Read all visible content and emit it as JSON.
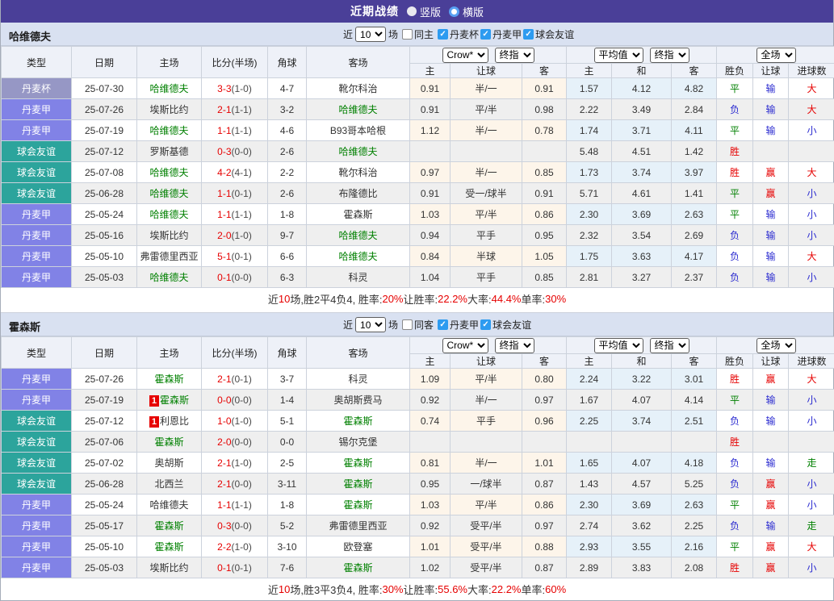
{
  "top_bar": {
    "title": "近期战绩",
    "radio_options": [
      {
        "label": "竖版",
        "selected": false
      },
      {
        "label": "横版",
        "selected": true
      }
    ]
  },
  "colors": {
    "top_bar_bg": "#4a3f98",
    "section_header_bg": "#d9e1f1",
    "cup_badge": "#9697c5",
    "league_badge": "#8182e6",
    "friendly_badge": "#2ca49c",
    "win_red": "#e60000",
    "lose_blue": "#2a2ad0",
    "draw_green": "#008000",
    "handicap_cell_bg": "#fdf5ea",
    "average_cell_bg": "#e6f1f9",
    "checkbox_checked": "#2d9bf0"
  },
  "columns": {
    "left": [
      "类型",
      "日期",
      "主场",
      "比分(半场)",
      "角球",
      "客场"
    ],
    "group1": {
      "selects": [
        "Crow*",
        "终指"
      ],
      "subs": [
        "主",
        "让球",
        "客"
      ]
    },
    "group2": {
      "selects": [
        "平均值",
        "终指"
      ],
      "subs": [
        "主",
        "和",
        "客"
      ]
    },
    "group3": {
      "selects": [
        "全场"
      ],
      "subs": [
        "胜负",
        "让球",
        "进球数"
      ]
    }
  },
  "sections": [
    {
      "title": "哈维德夫",
      "filters": {
        "near_label": "近",
        "count": "10",
        "games_label": "场",
        "same_label": "同主",
        "same_checked": false,
        "leagues": [
          {
            "label": "丹麦杯",
            "checked": true
          },
          {
            "label": "丹麦甲",
            "checked": true
          },
          {
            "label": "球会友谊",
            "checked": true
          }
        ]
      },
      "rows": [
        {
          "league_type": "丹麦杯",
          "league_class": "b-cup",
          "date": "25-07-30",
          "home": "哈维德夫",
          "home_highlight": true,
          "home_red_cards": "",
          "score_full": "3-3",
          "score_half": "(1-0)",
          "corners": "4-7",
          "away": "靴尔科治",
          "away_highlight": false,
          "handicap_odds": [
            "0.91",
            "半/一",
            "0.91"
          ],
          "average_odds": [
            "1.57",
            "4.12",
            "4.82"
          ],
          "results": [
            "平",
            "输",
            "大"
          ]
        },
        {
          "league_type": "丹麦甲",
          "league_class": "b-league",
          "date": "25-07-26",
          "home": "埃斯比约",
          "home_highlight": false,
          "home_red_cards": "",
          "score_full": "2-1",
          "score_half": "(1-1)",
          "corners": "3-2",
          "away": "哈维德夫",
          "away_highlight": true,
          "handicap_odds": [
            "0.91",
            "平/半",
            "0.98"
          ],
          "average_odds": [
            "2.22",
            "3.49",
            "2.84"
          ],
          "results": [
            "负",
            "输",
            "大"
          ]
        },
        {
          "league_type": "丹麦甲",
          "league_class": "b-league",
          "date": "25-07-19",
          "home": "哈维德夫",
          "home_highlight": true,
          "home_red_cards": "",
          "score_full": "1-1",
          "score_half": "(1-1)",
          "corners": "4-6",
          "away": "B93哥本哈根",
          "away_highlight": false,
          "handicap_odds": [
            "1.12",
            "半/一",
            "0.78"
          ],
          "average_odds": [
            "1.74",
            "3.71",
            "4.11"
          ],
          "results": [
            "平",
            "输",
            "小"
          ]
        },
        {
          "league_type": "球会友谊",
          "league_class": "b-friendly",
          "date": "25-07-12",
          "home": "罗斯基德",
          "home_highlight": false,
          "home_red_cards": "",
          "score_full": "0-3",
          "score_half": "(0-0)",
          "corners": "2-6",
          "away": "哈维德夫",
          "away_highlight": true,
          "handicap_odds": [
            "",
            "",
            ""
          ],
          "average_odds": [
            "5.48",
            "4.51",
            "1.42"
          ],
          "results": [
            "胜",
            "",
            ""
          ]
        },
        {
          "league_type": "球会友谊",
          "league_class": "b-friendly",
          "date": "25-07-08",
          "home": "哈维德夫",
          "home_highlight": true,
          "home_red_cards": "",
          "score_full": "4-2",
          "score_half": "(4-1)",
          "corners": "2-2",
          "away": "靴尔科治",
          "away_highlight": false,
          "handicap_odds": [
            "0.97",
            "半/一",
            "0.85"
          ],
          "average_odds": [
            "1.73",
            "3.74",
            "3.97"
          ],
          "results": [
            "胜",
            "赢",
            "大"
          ]
        },
        {
          "league_type": "球会友谊",
          "league_class": "b-friendly",
          "date": "25-06-28",
          "home": "哈维德夫",
          "home_highlight": true,
          "home_red_cards": "",
          "score_full": "1-1",
          "score_half": "(0-1)",
          "corners": "2-6",
          "away": "布隆德比",
          "away_highlight": false,
          "handicap_odds": [
            "0.91",
            "受一/球半",
            "0.91"
          ],
          "average_odds": [
            "5.71",
            "4.61",
            "1.41"
          ],
          "results": [
            "平",
            "赢",
            "小"
          ]
        },
        {
          "league_type": "丹麦甲",
          "league_class": "b-league",
          "date": "25-05-24",
          "home": "哈维德夫",
          "home_highlight": true,
          "home_red_cards": "",
          "score_full": "1-1",
          "score_half": "(1-1)",
          "corners": "1-8",
          "away": "霍森斯",
          "away_highlight": false,
          "handicap_odds": [
            "1.03",
            "平/半",
            "0.86"
          ],
          "average_odds": [
            "2.30",
            "3.69",
            "2.63"
          ],
          "results": [
            "平",
            "输",
            "小"
          ]
        },
        {
          "league_type": "丹麦甲",
          "league_class": "b-league",
          "date": "25-05-16",
          "home": "埃斯比约",
          "home_highlight": false,
          "home_red_cards": "",
          "score_full": "2-0",
          "score_half": "(1-0)",
          "corners": "9-7",
          "away": "哈维德夫",
          "away_highlight": true,
          "handicap_odds": [
            "0.94",
            "平手",
            "0.95"
          ],
          "average_odds": [
            "2.32",
            "3.54",
            "2.69"
          ],
          "results": [
            "负",
            "输",
            "小"
          ]
        },
        {
          "league_type": "丹麦甲",
          "league_class": "b-league",
          "date": "25-05-10",
          "home": "弗雷德里西亚",
          "home_highlight": false,
          "home_red_cards": "",
          "score_full": "5-1",
          "score_half": "(0-1)",
          "corners": "6-6",
          "away": "哈维德夫",
          "away_highlight": true,
          "handicap_odds": [
            "0.84",
            "半球",
            "1.05"
          ],
          "average_odds": [
            "1.75",
            "3.63",
            "4.17"
          ],
          "results": [
            "负",
            "输",
            "大"
          ]
        },
        {
          "league_type": "丹麦甲",
          "league_class": "b-league",
          "date": "25-05-03",
          "home": "哈维德夫",
          "home_highlight": true,
          "home_red_cards": "",
          "score_full": "0-1",
          "score_half": "(0-0)",
          "corners": "6-3",
          "away": "科灵",
          "away_highlight": false,
          "handicap_odds": [
            "1.04",
            "平手",
            "0.85"
          ],
          "average_odds": [
            "2.81",
            "3.27",
            "2.37"
          ],
          "results": [
            "负",
            "输",
            "小"
          ]
        }
      ],
      "summary_segments": [
        {
          "text": "近",
          "color": "dark"
        },
        {
          "text": "10",
          "color": "red"
        },
        {
          "text": "场,胜2平4负4, 胜率:",
          "color": "dark"
        },
        {
          "text": "20%",
          "color": "red"
        },
        {
          "text": " 让胜率:",
          "color": "dark"
        },
        {
          "text": "22.2%",
          "color": "red"
        },
        {
          "text": " 大率:",
          "color": "dark"
        },
        {
          "text": "44.4%",
          "color": "red"
        },
        {
          "text": " 单率:",
          "color": "dark"
        },
        {
          "text": "30%",
          "color": "red"
        }
      ]
    },
    {
      "title": "霍森斯",
      "filters": {
        "near_label": "近",
        "count": "10",
        "games_label": "场",
        "same_label": "同客",
        "same_checked": false,
        "leagues": [
          {
            "label": "丹麦甲",
            "checked": true
          },
          {
            "label": "球会友谊",
            "checked": true
          }
        ]
      },
      "rows": [
        {
          "league_type": "丹麦甲",
          "league_class": "b-league",
          "date": "25-07-26",
          "home": "霍森斯",
          "home_highlight": true,
          "home_red_cards": "",
          "score_full": "2-1",
          "score_half": "(0-1)",
          "corners": "3-7",
          "away": "科灵",
          "away_highlight": false,
          "handicap_odds": [
            "1.09",
            "平/半",
            "0.80"
          ],
          "average_odds": [
            "2.24",
            "3.22",
            "3.01"
          ],
          "results": [
            "胜",
            "赢",
            "大"
          ]
        },
        {
          "league_type": "丹麦甲",
          "league_class": "b-league",
          "date": "25-07-19",
          "home": "霍森斯",
          "home_highlight": true,
          "home_red_cards": "1",
          "score_full": "0-0",
          "score_half": "(0-0)",
          "corners": "1-4",
          "away": "奥胡斯费马",
          "away_highlight": false,
          "handicap_odds": [
            "0.92",
            "半/一",
            "0.97"
          ],
          "average_odds": [
            "1.67",
            "4.07",
            "4.14"
          ],
          "results": [
            "平",
            "输",
            "小"
          ]
        },
        {
          "league_type": "球会友谊",
          "league_class": "b-friendly",
          "date": "25-07-12",
          "home": "利恩比",
          "home_highlight": false,
          "home_red_cards": "1",
          "score_full": "1-0",
          "score_half": "(1-0)",
          "corners": "5-1",
          "away": "霍森斯",
          "away_highlight": true,
          "handicap_odds": [
            "0.74",
            "平手",
            "0.96"
          ],
          "average_odds": [
            "2.25",
            "3.74",
            "2.51"
          ],
          "results": [
            "负",
            "输",
            "小"
          ]
        },
        {
          "league_type": "球会友谊",
          "league_class": "b-friendly",
          "date": "25-07-06",
          "home": "霍森斯",
          "home_highlight": true,
          "home_red_cards": "",
          "score_full": "2-0",
          "score_half": "(0-0)",
          "corners": "0-0",
          "away": "锡尔克堡",
          "away_highlight": false,
          "handicap_odds": [
            "",
            "",
            ""
          ],
          "average_odds": [
            "",
            "",
            ""
          ],
          "results": [
            "胜",
            "",
            ""
          ]
        },
        {
          "league_type": "球会友谊",
          "league_class": "b-friendly",
          "date": "25-07-02",
          "home": "奥胡斯",
          "home_highlight": false,
          "home_red_cards": "",
          "score_full": "2-1",
          "score_half": "(1-0)",
          "corners": "2-5",
          "away": "霍森斯",
          "away_highlight": true,
          "handicap_odds": [
            "0.81",
            "半/一",
            "1.01"
          ],
          "average_odds": [
            "1.65",
            "4.07",
            "4.18"
          ],
          "results": [
            "负",
            "输",
            "走"
          ]
        },
        {
          "league_type": "球会友谊",
          "league_class": "b-friendly",
          "date": "25-06-28",
          "home": "北西兰",
          "home_highlight": false,
          "home_red_cards": "",
          "score_full": "2-1",
          "score_half": "(0-0)",
          "corners": "3-11",
          "away": "霍森斯",
          "away_highlight": true,
          "handicap_odds": [
            "0.95",
            "一/球半",
            "0.87"
          ],
          "average_odds": [
            "1.43",
            "4.57",
            "5.25"
          ],
          "results": [
            "负",
            "赢",
            "小"
          ]
        },
        {
          "league_type": "丹麦甲",
          "league_class": "b-league",
          "date": "25-05-24",
          "home": "哈维德夫",
          "home_highlight": false,
          "home_red_cards": "",
          "score_full": "1-1",
          "score_half": "(1-1)",
          "corners": "1-8",
          "away": "霍森斯",
          "away_highlight": true,
          "handicap_odds": [
            "1.03",
            "平/半",
            "0.86"
          ],
          "average_odds": [
            "2.30",
            "3.69",
            "2.63"
          ],
          "results": [
            "平",
            "赢",
            "小"
          ]
        },
        {
          "league_type": "丹麦甲",
          "league_class": "b-league",
          "date": "25-05-17",
          "home": "霍森斯",
          "home_highlight": true,
          "home_red_cards": "",
          "score_full": "0-3",
          "score_half": "(0-0)",
          "corners": "5-2",
          "away": "弗雷德里西亚",
          "away_highlight": false,
          "handicap_odds": [
            "0.92",
            "受平/半",
            "0.97"
          ],
          "average_odds": [
            "2.74",
            "3.62",
            "2.25"
          ],
          "results": [
            "负",
            "输",
            "走"
          ]
        },
        {
          "league_type": "丹麦甲",
          "league_class": "b-league",
          "date": "25-05-10",
          "home": "霍森斯",
          "home_highlight": true,
          "home_red_cards": "",
          "score_full": "2-2",
          "score_half": "(1-0)",
          "corners": "3-10",
          "away": "欧登塞",
          "away_highlight": false,
          "handicap_odds": [
            "1.01",
            "受平/半",
            "0.88"
          ],
          "average_odds": [
            "2.93",
            "3.55",
            "2.16"
          ],
          "results": [
            "平",
            "赢",
            "大"
          ]
        },
        {
          "league_type": "丹麦甲",
          "league_class": "b-league",
          "date": "25-05-03",
          "home": "埃斯比约",
          "home_highlight": false,
          "home_red_cards": "",
          "score_full": "0-1",
          "score_half": "(0-1)",
          "corners": "7-6",
          "away": "霍森斯",
          "away_highlight": true,
          "handicap_odds": [
            "1.02",
            "受平/半",
            "0.87"
          ],
          "average_odds": [
            "2.89",
            "3.83",
            "2.08"
          ],
          "results": [
            "胜",
            "赢",
            "小"
          ]
        }
      ],
      "summary_segments": [
        {
          "text": "近",
          "color": "dark"
        },
        {
          "text": "10",
          "color": "red"
        },
        {
          "text": "场,胜3平3负4, 胜率:",
          "color": "dark"
        },
        {
          "text": "30%",
          "color": "red"
        },
        {
          "text": " 让胜率:",
          "color": "dark"
        },
        {
          "text": "55.6%",
          "color": "red"
        },
        {
          "text": " 大率:",
          "color": "dark"
        },
        {
          "text": "22.2%",
          "color": "red"
        },
        {
          "text": " 单率:",
          "color": "dark"
        },
        {
          "text": "60%",
          "color": "red"
        }
      ]
    }
  ]
}
